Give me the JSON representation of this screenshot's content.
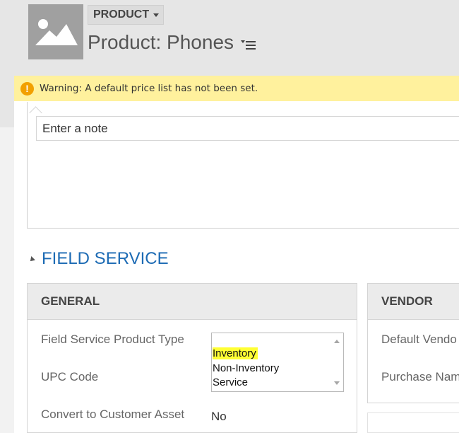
{
  "header": {
    "entity_label": "PRODUCT",
    "record_title": "Product: Phones",
    "avatar_icon": "image-placeholder-icon",
    "menu_icon": "list-menu-icon"
  },
  "warning": {
    "icon_glyph": "!",
    "text": "Warning: A default price list has not been set."
  },
  "notes": {
    "placeholder": "Enter a note"
  },
  "section": {
    "title": "FIELD SERVICE"
  },
  "general": {
    "heading": "GENERAL",
    "labels": {
      "product_type": "Field Service Product Type",
      "upc_code": "UPC Code",
      "convert_asset": "Convert to Customer Asset"
    },
    "product_type_options": [
      "Inventory",
      "Non-Inventory",
      "Service"
    ],
    "highlighted_option": "Inventory",
    "convert_asset_value": "No"
  },
  "vendor": {
    "heading": "VENDOR",
    "labels": {
      "default_vendor": "Default Vendo",
      "purchase_name": "Purchase Nam"
    }
  },
  "colors": {
    "warning_bg": "#fff19d",
    "warning_icon": "#f2a000",
    "section_title": "#1d6bb4",
    "highlight": "#ffff33"
  }
}
